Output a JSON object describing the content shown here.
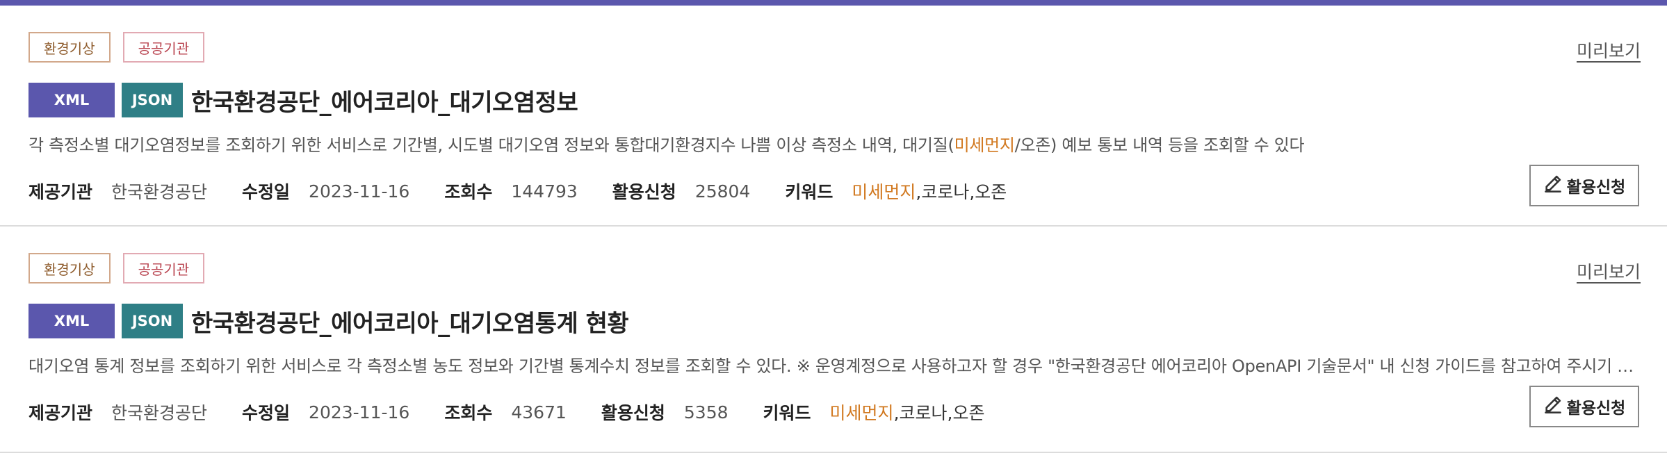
{
  "items": [
    {
      "categories": [
        "환경기상",
        "공공기관"
      ],
      "preview_label": "미리보기",
      "formats": [
        "XML",
        "JSON"
      ],
      "title": "한국환경공단_에어코리아_대기오염정보",
      "description_pre": "각 측정소별 대기오염정보를 조회하기 위한 서비스로 기간별, 시도별 대기오염 정보와 통합대기환경지수 나쁨 이상 측정소 내역, 대기질(",
      "description_hl": "미세먼지",
      "description_post": "/오존) 예보 통보 내역 등을 조회할 수 있다",
      "meta": {
        "provider_label": "제공기관",
        "provider": "한국환경공단",
        "modified_label": "수정일",
        "modified": "2023-11-16",
        "views_label": "조회수",
        "views": "144793",
        "applications_label": "활용신청",
        "applications": "25804",
        "keywords_label": "키워드",
        "keyword_highlight": "미세먼지",
        "keywords_rest": ",코로나,오존"
      },
      "apply_label": "활용신청"
    },
    {
      "categories": [
        "환경기상",
        "공공기관"
      ],
      "preview_label": "미리보기",
      "formats": [
        "XML",
        "JSON"
      ],
      "title": "한국환경공단_에어코리아_대기오염통계 현황",
      "description_pre": "대기오염 통계 정보를 조회하기 위한 서비스로 각 측정소별 농도 정보와 기간별 통계수치 정보를 조회할 수 있다. ※ 운영계정으로 사용하고자 할 경우 \"한국환경공단 에어코리아 OpenAPI 기술문서\" 내 신청 가이드를 참고하여 주시기 바랍니다",
      "description_hl": "",
      "description_post": "",
      "meta": {
        "provider_label": "제공기관",
        "provider": "한국환경공단",
        "modified_label": "수정일",
        "modified": "2023-11-16",
        "views_label": "조회수",
        "views": "43671",
        "applications_label": "활용신청",
        "applications": "5358",
        "keywords_label": "키워드",
        "keyword_highlight": "미세먼지",
        "keywords_rest": ",코로나,오존"
      },
      "apply_label": "활용신청"
    }
  ],
  "icons": {
    "apply": "pencil-icon"
  },
  "colors": {
    "accent": "#5b57ad",
    "json_badge": "#2f7f86",
    "highlight": "#d1781f"
  }
}
